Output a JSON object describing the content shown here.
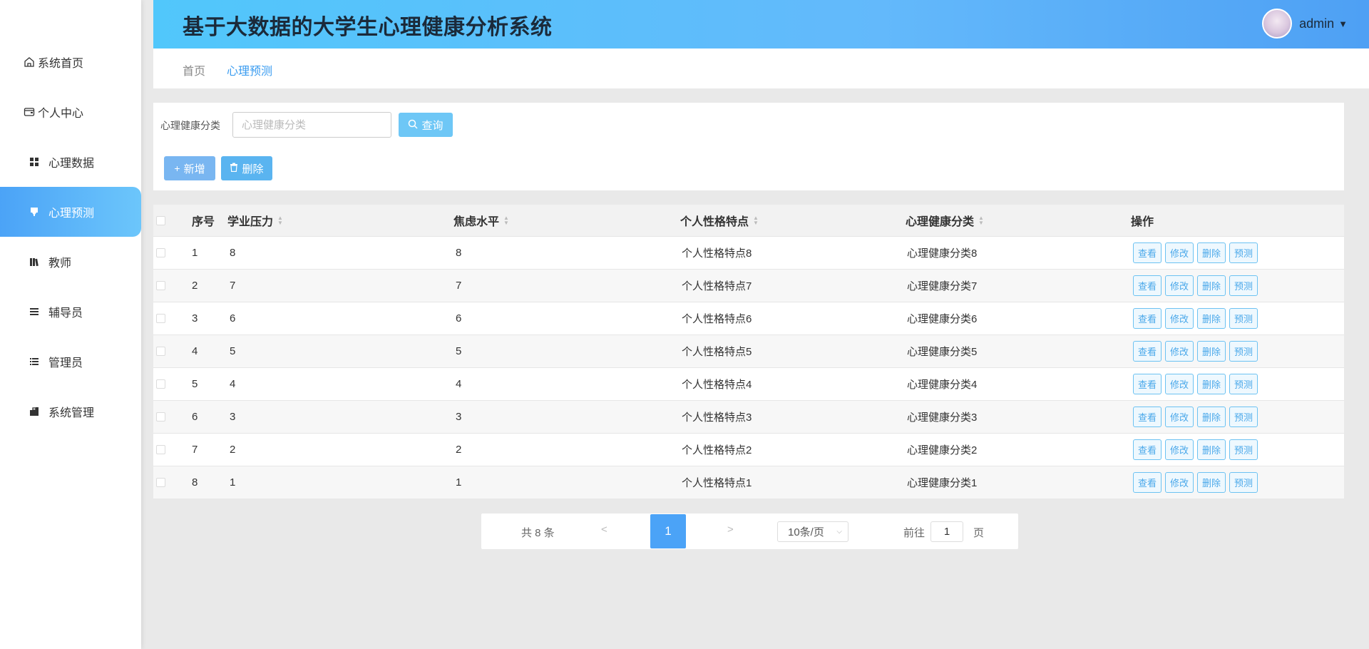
{
  "app": {
    "title": "基于大数据的大学生心理健康分析系统",
    "user": "admin"
  },
  "sidebar": {
    "items": [
      {
        "label": "系统首页",
        "icon": "home-icon"
      },
      {
        "label": "个人中心",
        "icon": "wallet-icon"
      },
      {
        "label": "心理数据",
        "icon": "grid-icon"
      },
      {
        "label": "心理预测",
        "icon": "marker-icon",
        "active": true
      },
      {
        "label": "教师",
        "icon": "books-icon"
      },
      {
        "label": "辅导员",
        "icon": "list-icon"
      },
      {
        "label": "管理员",
        "icon": "list-icon"
      },
      {
        "label": "系统管理",
        "icon": "briefcase-icon"
      }
    ]
  },
  "breadcrumb": {
    "home": "首页",
    "current": "心理预测"
  },
  "search": {
    "label": "心理健康分类",
    "placeholder": "心理健康分类",
    "query_label": "查询"
  },
  "toolbar": {
    "add_label": "新增",
    "delete_label": "删除"
  },
  "table": {
    "headers": {
      "index": "序号",
      "pressure": "学业压力",
      "anxiety": "焦虑水平",
      "personality": "个人性格特点",
      "category": "心理健康分类",
      "actions": "操作"
    },
    "action_labels": {
      "view": "查看",
      "edit": "修改",
      "delete": "删除",
      "predict": "预测"
    },
    "rows": [
      {
        "index": "1",
        "pressure": "8",
        "anxiety": "8",
        "personality": "个人性格特点8",
        "category": "心理健康分类8"
      },
      {
        "index": "2",
        "pressure": "7",
        "anxiety": "7",
        "personality": "个人性格特点7",
        "category": "心理健康分类7"
      },
      {
        "index": "3",
        "pressure": "6",
        "anxiety": "6",
        "personality": "个人性格特点6",
        "category": "心理健康分类6"
      },
      {
        "index": "4",
        "pressure": "5",
        "anxiety": "5",
        "personality": "个人性格特点5",
        "category": "心理健康分类5"
      },
      {
        "index": "5",
        "pressure": "4",
        "anxiety": "4",
        "personality": "个人性格特点4",
        "category": "心理健康分类4"
      },
      {
        "index": "6",
        "pressure": "3",
        "anxiety": "3",
        "personality": "个人性格特点3",
        "category": "心理健康分类3"
      },
      {
        "index": "7",
        "pressure": "2",
        "anxiety": "2",
        "personality": "个人性格特点2",
        "category": "心理健康分类2"
      },
      {
        "index": "8",
        "pressure": "1",
        "anxiety": "1",
        "personality": "个人性格特点1",
        "category": "心理健康分类1"
      }
    ]
  },
  "pagination": {
    "total_text": "共 8 条",
    "prev": "<",
    "current_page": "1",
    "next": ">",
    "page_size": "10条/页",
    "goto_label": "前往",
    "goto_value": "1",
    "page_unit": "页"
  },
  "colors": {
    "accent": "#4ba3f7",
    "header_start": "#51c7fb",
    "button_outline": "#6cc2f2"
  }
}
